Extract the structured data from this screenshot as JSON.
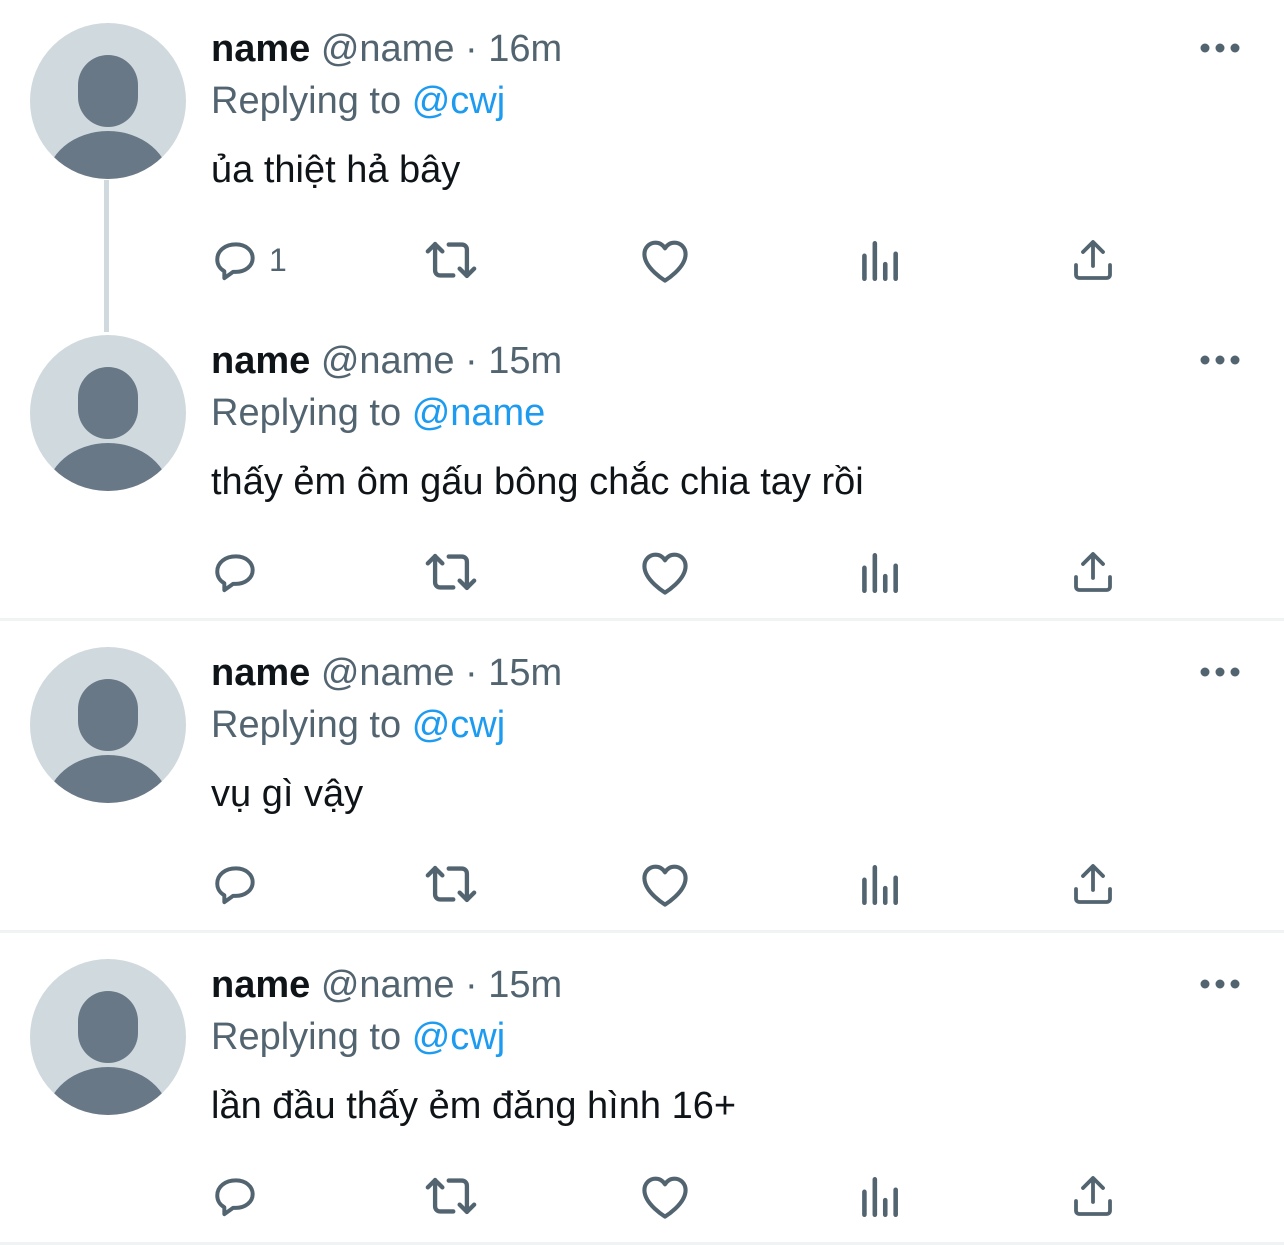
{
  "colors": {
    "name_text": "#0f1419",
    "muted_text": "#536471",
    "mention": "#1d9bf0",
    "avatar_bg": "#cfd9de",
    "avatar_figure": "#687886",
    "divider": "#eff3f4"
  },
  "icons": {
    "more": "more-horizontal-icon",
    "reply": "reply-bubble-icon",
    "retweet": "retweet-icon",
    "like": "heart-icon",
    "views": "views-bar-chart-icon",
    "share": "share-upload-icon"
  },
  "tweets": [
    {
      "name": "name",
      "handle": "@name",
      "separator": "·",
      "time": "16m",
      "replying_prefix": "Replying to",
      "replying_to": "@cwj",
      "text": "ủa thiệt hả bây",
      "reply_count": "1"
    },
    {
      "name": "name",
      "handle": "@name",
      "separator": "·",
      "time": "15m",
      "replying_prefix": "Replying to",
      "replying_to": "@name",
      "text": "thấy ẻm ôm gấu bông chắc chia tay rồi",
      "reply_count": ""
    },
    {
      "name": "name",
      "handle": "@name",
      "separator": "·",
      "time": "15m",
      "replying_prefix": "Replying to",
      "replying_to": "@cwj",
      "text": "vụ gì vậy",
      "reply_count": ""
    },
    {
      "name": "name",
      "handle": "@name",
      "separator": "·",
      "time": "15m",
      "replying_prefix": "Replying to",
      "replying_to": "@cwj",
      "text": "lần đầu thấy ẻm đăng hình 16+",
      "reply_count": ""
    }
  ]
}
